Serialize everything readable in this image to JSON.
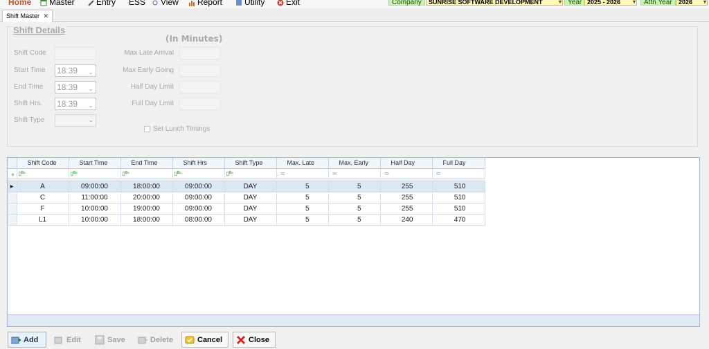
{
  "menu": {
    "items": [
      {
        "label": "Home"
      },
      {
        "label": "Master"
      },
      {
        "label": "Entry"
      },
      {
        "label": "ESS"
      },
      {
        "label": "View"
      },
      {
        "label": "Report"
      },
      {
        "label": "Utility"
      },
      {
        "label": "Exit"
      }
    ],
    "company_label": "Company",
    "company_value": "SUNRISE SOFTWARE DEVELOPMENT",
    "year_label": "Year",
    "year_value": "2025 - 2026",
    "attn_year_label": "Attn Year",
    "attn_year_value": "2026"
  },
  "tab": {
    "label": "Shift Master",
    "close": "✕"
  },
  "details": {
    "title": "Shift Details",
    "in_minutes": "(In Minutes)",
    "shift_code_label": "Shift Code",
    "start_time_label": "Start Time",
    "start_time_value": "18:39",
    "end_time_label": "End Time",
    "end_time_value": "18:39",
    "shift_hrs_label": "Shift Hrs.",
    "shift_hrs_value": "18:39",
    "shift_type_label": "Shift Type",
    "max_late_label": "Max Late Arrival",
    "max_early_label": "Max Early Going",
    "half_day_label": "Half Day Limit",
    "full_day_label": "Full Day Limit",
    "lunch_label": "Set Lunch Timings"
  },
  "grid": {
    "columns": [
      "Shift Code",
      "Start Time",
      "End Time",
      "Shift Hrs",
      "Shift Type",
      "Max. Late",
      "Max. Early",
      "Half Day",
      "Full Day"
    ],
    "rows": [
      [
        "A",
        "09:00:00",
        "18:00:00",
        "09:00:00",
        "DAY",
        "5",
        "5",
        "255",
        "510"
      ],
      [
        "C",
        "11:00:00",
        "20:00:00",
        "09:00:00",
        "DAY",
        "5",
        "5",
        "255",
        "510"
      ],
      [
        "F",
        "10:00:00",
        "19:00:00",
        "09:00:00",
        "DAY",
        "5",
        "5",
        "255",
        "510"
      ],
      [
        "L1",
        "10:00:00",
        "18:00:00",
        "08:00:00",
        "DAY",
        "5",
        "5",
        "240",
        "470"
      ]
    ]
  },
  "buttons": {
    "add": "Add",
    "edit": "Edit",
    "save": "Save",
    "delete": "Delete",
    "cancel": "Cancel",
    "close": "Close"
  },
  "colors": {
    "accent": "#1d3a5a",
    "selected_row": "#dde7f3",
    "company_label_bg": "#c9f2b3",
    "company_value_bg": "#fff7b8"
  }
}
